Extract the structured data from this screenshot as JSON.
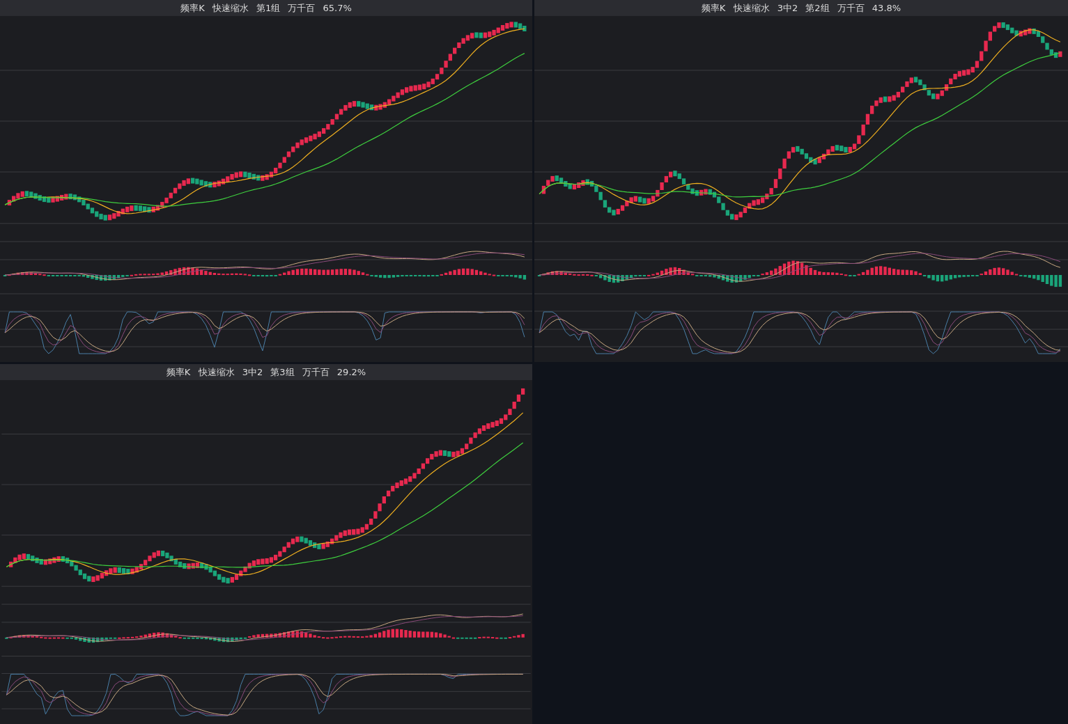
{
  "panels": [
    {
      "title": "频率K 快速缩水 第1组 万千百 65.7%"
    },
    {
      "title": "频率K 快速缩水 3中2 第2组 万千百 43.8%"
    },
    {
      "title": "频率K 快速缩水 3中2 第3组 万千百 29.2%"
    }
  ]
}
